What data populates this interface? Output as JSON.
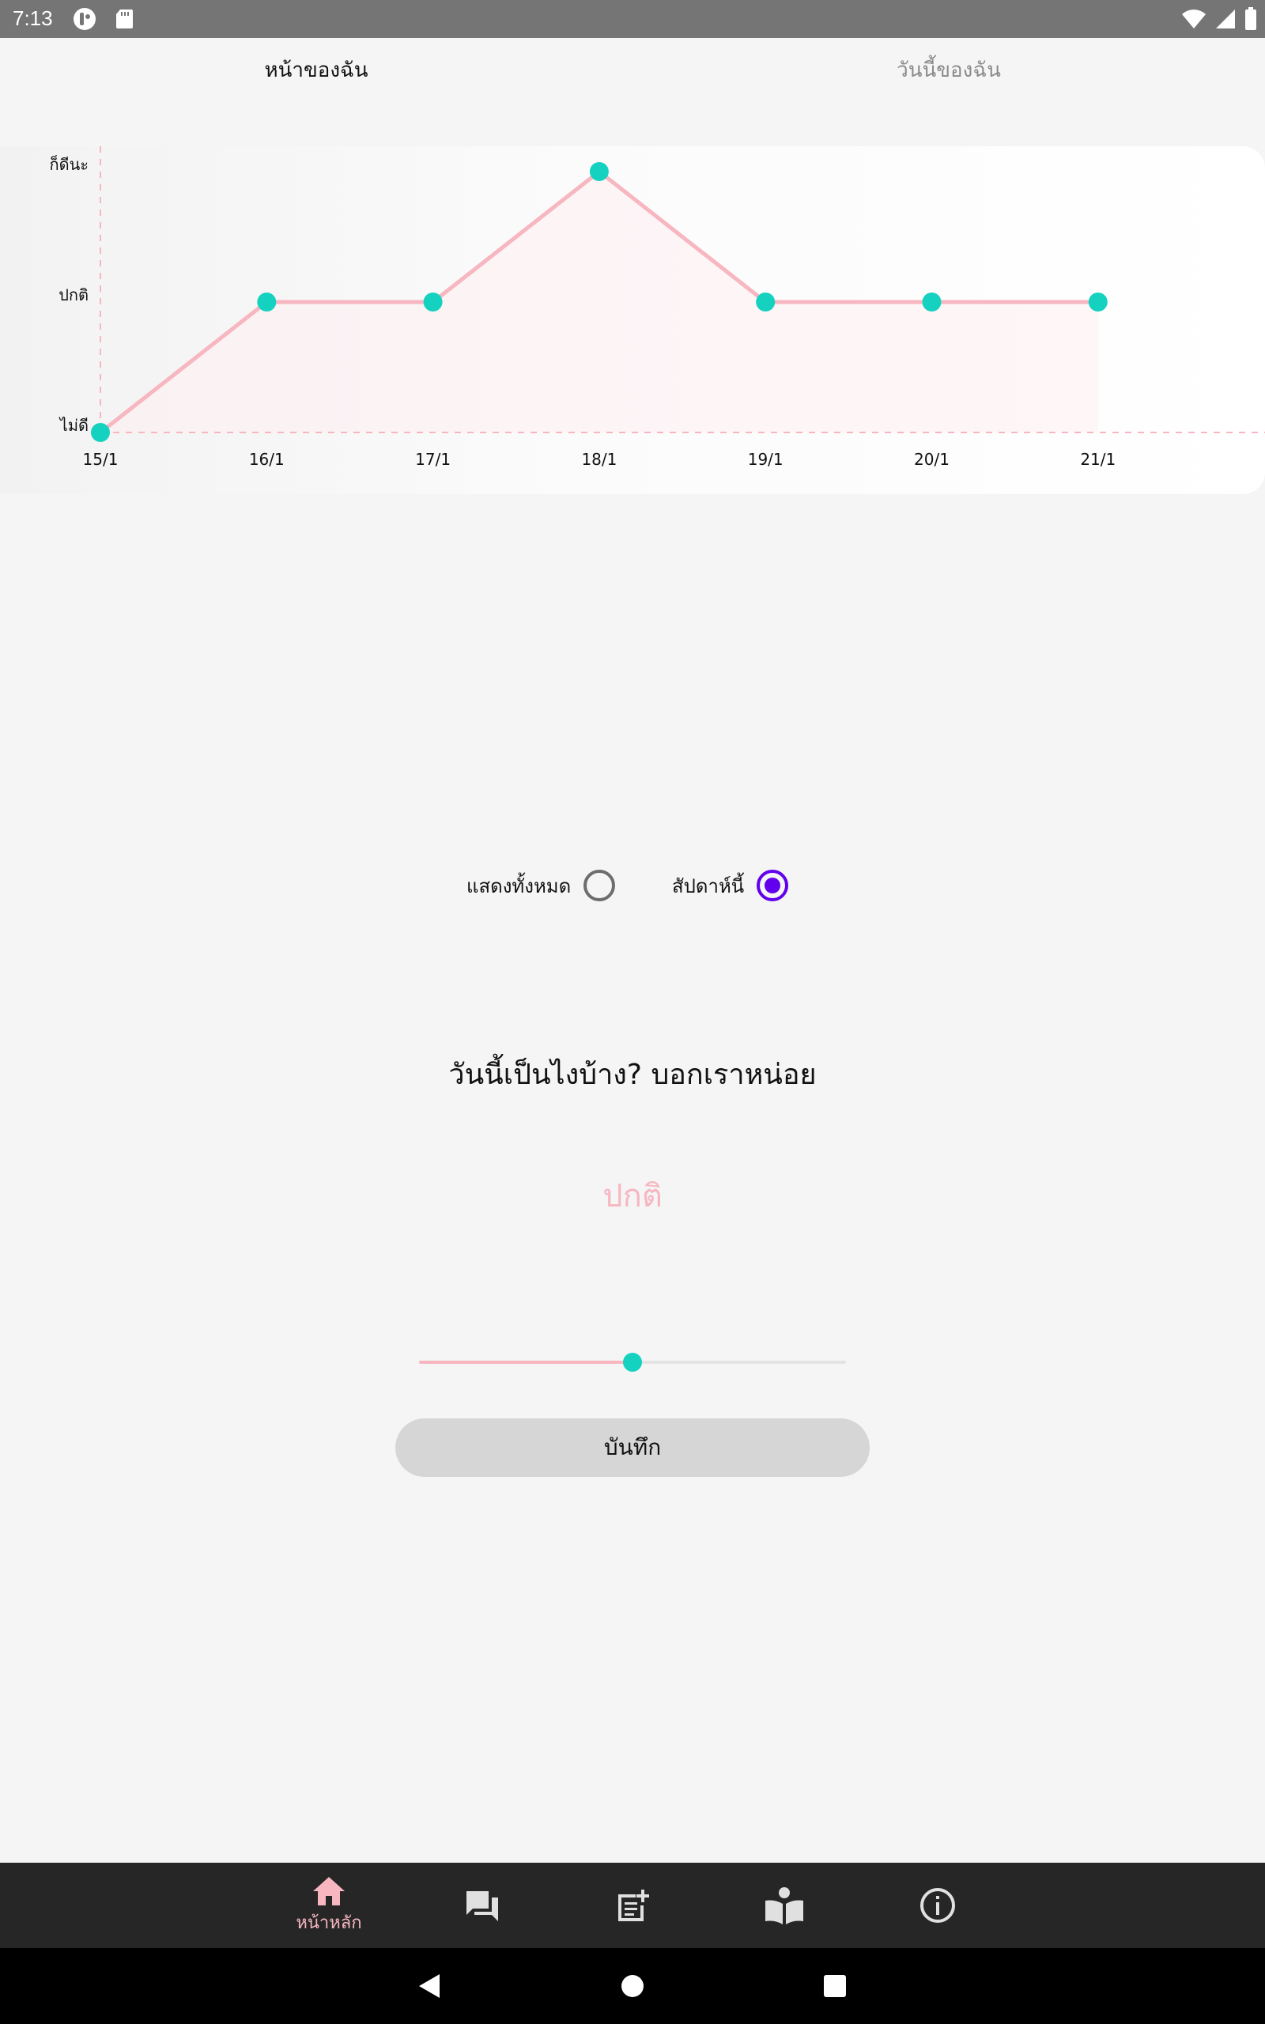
{
  "status_bar": {
    "time": "7:13"
  },
  "tabs": [
    {
      "label": "หน้าของฉัน",
      "active": true
    },
    {
      "label": "วันนี้ของฉัน",
      "active": false
    }
  ],
  "chart_data": {
    "type": "line",
    "categories": [
      "15/1",
      "16/1",
      "17/1",
      "18/1",
      "19/1",
      "20/1",
      "21/1"
    ],
    "y_levels": [
      "ไม่ดี",
      "ปกติ",
      "ก็ดีนะ"
    ],
    "series": [
      {
        "values": [
          0,
          1,
          1,
          2,
          1,
          1,
          1
        ]
      }
    ],
    "ylim": [
      0,
      2
    ],
    "grid": false,
    "colors": {
      "line": "#f7b6c0",
      "point": "#15d2c0",
      "fill": "#fdeef0",
      "axis": "#f7b6c0"
    }
  },
  "filter": {
    "options": [
      {
        "label": "แสดงทั้งหมด",
        "checked": false
      },
      {
        "label": "สัปดาห์นี้",
        "checked": true
      }
    ]
  },
  "mood": {
    "question": "วันนี้เป็นไงบ้าง? บอกเราหน่อย",
    "current_label": "ปกติ",
    "slider_fraction": 0.5
  },
  "save_label": "บันทึก",
  "bottom_nav": {
    "items": [
      {
        "icon": "home-icon",
        "label": "หน้าหลัก",
        "active": true
      },
      {
        "icon": "forum-icon",
        "label": "",
        "active": false
      },
      {
        "icon": "note-add-icon",
        "label": "",
        "active": false
      },
      {
        "icon": "book-icon",
        "label": "",
        "active": false
      },
      {
        "icon": "info-icon",
        "label": "",
        "active": false
      }
    ]
  },
  "colors": {
    "accent_pink": "#f7b6c0",
    "accent_teal": "#15d2c0",
    "radio_checked": "#6200ee"
  }
}
